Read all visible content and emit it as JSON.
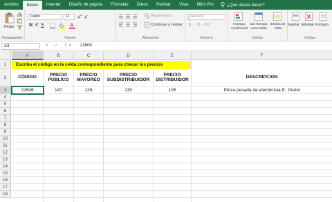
{
  "tabs": [
    "Archivo",
    "Inicio",
    "Insertar",
    "Diseño de página",
    "Fórmulas",
    "Datos",
    "Revisar",
    "Vista",
    "Nitro Pro"
  ],
  "tell_me": "¿Qué desea hacer?",
  "ribbon": {
    "clipboard": {
      "paste": "Pegar",
      "label": "Portapapeles"
    },
    "font": {
      "name": "Calibri",
      "size": "11",
      "label": "Fuente"
    },
    "alignment": {
      "wrap": "Ajustar texto",
      "merge": "Combinar y centrar",
      "label": "Alineación"
    },
    "number": {
      "format": "General",
      "label": "Número"
    },
    "styles": {
      "conditional": "Formato condicional",
      "as_table": "Dar formato como tabla",
      "cell_styles": "Estilos de celda",
      "label": "Estilos"
    },
    "cells": {
      "insert": "Insertar",
      "delete": "Eliminar",
      "format": "Formato",
      "label": "Celdas"
    }
  },
  "formula_bar": {
    "name_box": "A3",
    "value": "22606",
    "icons": "× ✓ fx"
  },
  "columns": [
    "A",
    "B",
    "C",
    "D",
    "E",
    "F"
  ],
  "rows": [
    "1",
    "2",
    "3",
    "4",
    "5",
    "6",
    "7",
    "8",
    "9",
    "10",
    "11",
    "12",
    "13",
    "14",
    "15",
    "16",
    "17",
    "18"
  ],
  "sheet": {
    "banner": "Escriba el código en la celda correspondiente para checar los precios",
    "headers": [
      "CÓDIGO",
      "PRECIO PÚBLICO",
      "PRECIO MAYOREO",
      "PRECIO SUBDISTRIBUIDOR",
      "PRECIO DISTRIBUIDOR",
      "DESCRIPCION"
    ],
    "row3": [
      "22606",
      "147",
      "126",
      "115",
      "105",
      "Pinza pesada de electricista 8', Pretul"
    ]
  }
}
